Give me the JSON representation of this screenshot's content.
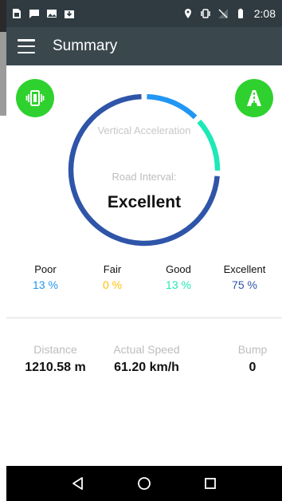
{
  "status_bar": {
    "time": "2:08"
  },
  "app_bar": {
    "title": "Summary"
  },
  "gauge": {
    "acceleration_label": "Vertical Acceleration",
    "road_interval_label": "Road Interval:",
    "road_interval_value": "Excellent",
    "colors": {
      "poor": "#2196f3",
      "fair": "#ffc107",
      "good": "#1de9b6",
      "excellent": "#2f55a8"
    }
  },
  "categories": [
    {
      "name": "Poor",
      "percent": "13 %",
      "fraction": 0.13,
      "color": "#2196f3"
    },
    {
      "name": "Fair",
      "percent": "0 %",
      "fraction": 0.0,
      "color": "#ffc107"
    },
    {
      "name": "Good",
      "percent": "13 %",
      "fraction": 0.13,
      "color": "#1de9b6"
    },
    {
      "name": "Excellent",
      "percent": "75 %",
      "fraction": 0.75,
      "color": "#2f55a8"
    }
  ],
  "stats": {
    "distance_label": "Distance",
    "distance_value": "1210.58 m",
    "speed_label": "Actual Speed",
    "speed_value": "61.20 km/h",
    "bump_label": "Bump",
    "bump_value": "0"
  },
  "colors": {
    "fab_green": "#2fd12f",
    "app_bar": "#3a484e",
    "status_bar": "#2f3b40"
  },
  "icons": {
    "fab_left": "vibration-icon",
    "fab_right": "road-icon",
    "menu": "hamburger-menu-icon",
    "nav": [
      "back-icon",
      "home-icon",
      "recents-icon"
    ]
  }
}
